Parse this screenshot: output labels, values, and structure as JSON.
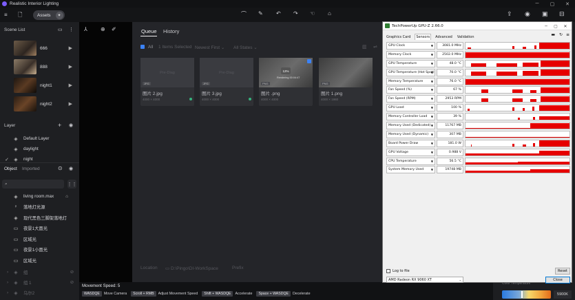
{
  "app": {
    "title": "Realistic Interior Lighting"
  },
  "toolbar": {
    "assets_label": "Assets"
  },
  "scene_list": {
    "title": "Scene List",
    "items": [
      {
        "label": "666"
      },
      {
        "label": "888"
      },
      {
        "label": "night1"
      },
      {
        "label": "night2"
      }
    ]
  },
  "layer": {
    "title": "Layer",
    "items": [
      {
        "label": "Default Layer"
      },
      {
        "label": "daylight"
      },
      {
        "label": "night"
      }
    ]
  },
  "object": {
    "tab_object": "Object",
    "tab_imported": "Imported",
    "items": [
      {
        "label": "living room.max"
      },
      {
        "label": "落地灯光源"
      },
      {
        "label": "现代黑色三脚架落地灯"
      },
      {
        "label": "夜景1大面光"
      },
      {
        "label": "区域光"
      },
      {
        "label": "夜景1小面光"
      },
      {
        "label": "区域光"
      }
    ],
    "groups": [
      {
        "label": "组"
      },
      {
        "label": "组 1"
      },
      {
        "label": "乌尔2"
      }
    ]
  },
  "queue": {
    "tab_queue": "Queue",
    "tab_history": "History",
    "filter_all": "All",
    "items_selected": "1 Items Selected",
    "sort": "Newest First",
    "status": "All States",
    "cards": [
      {
        "name": "图片 2.jpg",
        "placeholder": "Pre-Diag",
        "size": "4000 × 4000",
        "tag": "JPG"
      },
      {
        "name": "图片 3.jpg",
        "placeholder": "Pre-Diag",
        "size": "4000 × 4000",
        "tag": "JPG"
      },
      {
        "name": "图片 .png",
        "placeholder": "",
        "size": "4000 × 4000",
        "tag": "PNG",
        "progress": "12%",
        "progress_label": "Rendering 00:04:47"
      },
      {
        "name": "图片 1.png",
        "placeholder": "",
        "size": "4000 × 1980",
        "tag": "PNG"
      }
    ],
    "location_label": "Location",
    "location_path": "D:\\Pingo\\DI-WorkSpace",
    "prefix_label": "Prefix"
  },
  "bottom": {
    "speed": "Movement Speed: 5",
    "hints": [
      {
        "key": "WASDQE",
        "label": "Move Camera"
      },
      {
        "key": "Scroll + RMB",
        "label": "Adjust Movement Speed"
      },
      {
        "key": "Shift + WASDQE",
        "label": "Accelerate"
      },
      {
        "key": "Space + WASDQE",
        "label": "Decelerate"
      }
    ]
  },
  "right_strip": {
    "temp_label": "Color Temperature",
    "temp_value": "5900K"
  },
  "gpuz": {
    "title": "TechPowerUp GPU-Z 2.66.0",
    "tabs": [
      "Graphics Card",
      "Sensors",
      "Advanced",
      "Validation"
    ],
    "active_tab": "Sensors",
    "sensors": [
      {
        "name": "GPU Clock",
        "value": "3081.0 MHz"
      },
      {
        "name": "Memory Clock",
        "value": "2502.0 MHz"
      },
      {
        "name": "GPU Temperature",
        "value": "48.0 °C"
      },
      {
        "name": "GPU Temperature (Hot Spot)",
        "value": "70.0 °C"
      },
      {
        "name": "Memory Temperature",
        "value": "76.0 °C"
      },
      {
        "name": "Fan Speed (%)",
        "value": "67 %"
      },
      {
        "name": "Fan Speed (RPM)",
        "value": "2953 RPM"
      },
      {
        "name": "GPU Load",
        "value": "100 %"
      },
      {
        "name": "Memory Controller Load",
        "value": "39 %"
      },
      {
        "name": "Memory Used (Dedicated)",
        "value": "11767 MB"
      },
      {
        "name": "Memory Used (Dynamic)",
        "value": "307 MB"
      },
      {
        "name": "Board Power Draw",
        "value": "181.0 W"
      },
      {
        "name": "GPU Voltage",
        "value": "0.988 V"
      },
      {
        "name": "CPU Temperature",
        "value": "56.5 °C"
      },
      {
        "name": "System Memory Used",
        "value": "19748 MB"
      }
    ],
    "log_to_file": "Log to file",
    "reset": "Reset",
    "close": "Close",
    "device": "AMD Radeon RX 9060 XT"
  },
  "colors": {
    "accent": "#3b82f6",
    "graph": "#e60000",
    "brand": "#7b5cff"
  }
}
